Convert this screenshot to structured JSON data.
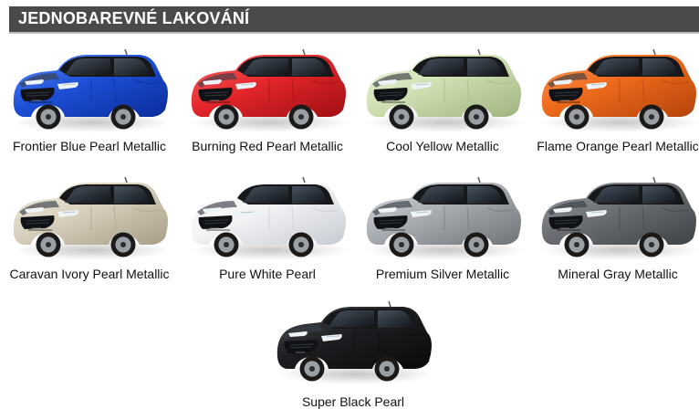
{
  "header": {
    "title": "JEDNOBAREVNÉ LAKOVÁNÍ"
  },
  "colors": [
    {
      "name": "Frontier Blue Pearl Metallic",
      "body": "#1d4fd6",
      "shade": "#0b2c9a",
      "highlight": "#5a8cff"
    },
    {
      "name": "Burning Red Pearl Metallic",
      "body": "#e3262b",
      "shade": "#9f0f14",
      "highlight": "#ff6b6e"
    },
    {
      "name": "Cool Yellow Metallic",
      "body": "#cfe0b2",
      "shade": "#9fb37f",
      "highlight": "#eef6df"
    },
    {
      "name": "Flame Orange Pearl Metallic",
      "body": "#ee6a1c",
      "shade": "#b3440b",
      "highlight": "#ff9a58"
    },
    {
      "name": "Caravan Ivory Pearl Metallic",
      "body": "#d8d0bd",
      "shade": "#a79d87",
      "highlight": "#f2eee3"
    },
    {
      "name": "Pure White Pearl",
      "body": "#f2f3f5",
      "shade": "#c7cbd2",
      "highlight": "#ffffff"
    },
    {
      "name": "Premium Silver Metallic",
      "body": "#a9adb2",
      "shade": "#6f7378",
      "highlight": "#d7dbe0"
    },
    {
      "name": "Mineral Gray Metallic",
      "body": "#6b6e72",
      "shade": "#3f4245",
      "highlight": "#9da0a4"
    },
    {
      "name": "Super Black Pearl",
      "body": "#1b1d20",
      "shade": "#090a0b",
      "highlight": "#4c5054"
    }
  ],
  "common": {
    "car_icon": "car-front-three-quarter-icon",
    "roof_color": "#161719",
    "wheel_color": "#1a1a1a",
    "rim_color": "#9b9fa4"
  }
}
